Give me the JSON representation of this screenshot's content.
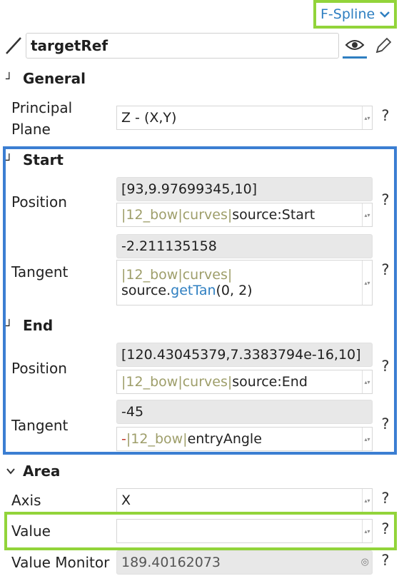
{
  "header": {
    "type_label": "F-Spline"
  },
  "name": {
    "value": "targetRef"
  },
  "sections": {
    "general": {
      "title": "General",
      "principal_plane_label": "Principal Plane",
      "principal_plane_label_l1": "Principal",
      "principal_plane_label_l2": "Plane",
      "principal_plane_value": "Z - (X,Y)"
    },
    "start": {
      "title": "Start",
      "position_label": "Position",
      "position_value": "[93,9.97699345,10]",
      "position_expr": {
        "p1": "|",
        "r1": "12_bow",
        "p2": "|",
        "r2": "curves",
        "p3": "|",
        "k": "source",
        "s": ":",
        "t": "Start"
      },
      "tangent_label": "Tangent",
      "tangent_value": "-2.211135158",
      "tangent_expr": {
        "p1": "|",
        "r1": "12_bow",
        "p2": "|",
        "r2": "curves",
        "p3": "|",
        "k": "source",
        "dot": ".",
        "fn": "getTan",
        "args": "(0, 2)"
      }
    },
    "end": {
      "title": "End",
      "position_label": "Position",
      "position_value": "[120.43045379,7.3383794e-16,10]",
      "position_expr": {
        "p1": "|",
        "r1": "12_bow",
        "p2": "|",
        "r2": "curves",
        "p3": "|",
        "k": "source",
        "s": ":",
        "t": "End"
      },
      "tangent_label": "Tangent",
      "tangent_value": "-45",
      "tangent_expr": {
        "op": "-",
        "p1": "|",
        "r1": "12_bow",
        "p2": "|",
        "k": "entryAngle"
      }
    },
    "area": {
      "title": "Area",
      "axis_label": "Axis",
      "axis_value": "X",
      "value_label": "Value",
      "value_value": "",
      "monitor_label": "Value Monitor",
      "monitor_value": "189.40162073"
    }
  },
  "help_glyph": "?",
  "icons": [
    "chevron-down-icon",
    "line-icon",
    "eye-icon",
    "pencil-icon",
    "collapse-icon",
    "expand-icon",
    "spinner-icon",
    "monitor-icon"
  ],
  "colors": {
    "accent_blue": "#3b7ed2",
    "highlight_green": "#92d43a",
    "ref_olive": "#9e9e6a",
    "fn_blue": "#2f7fc1"
  }
}
